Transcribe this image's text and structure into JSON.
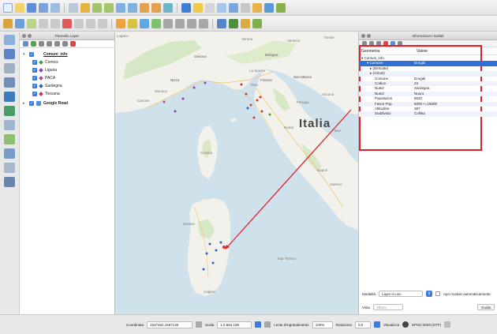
{
  "layers_panel": {
    "title": "Pannello Layer",
    "group": {
      "label": "Comuni_info"
    },
    "items": [
      {
        "label": "Comics",
        "color": "#3da03a"
      },
      {
        "label": "Liguria",
        "color": "#8e3fb5"
      },
      {
        "label": "PACA",
        "color": "#c03c9e"
      },
      {
        "label": "Sardegna",
        "color": "#2a64c8"
      },
      {
        "label": "Toscana",
        "color": "#c63b3b"
      }
    ],
    "basemap": {
      "label": "Google Road"
    }
  },
  "map": {
    "labels": {
      "italia": "Italia",
      "lugano": "Lugano",
      "verona": "Verona",
      "venezia": "Venezia",
      "trieste": "Trieste",
      "genova": "Genova",
      "bologna": "Bologna",
      "nizza": "Nizza",
      "monaco": "Monaco",
      "la_spezia": "La Spezia",
      "pisa": "Pisa",
      "firenze": "Firenze",
      "san_marino": "San Marino",
      "ancona": "Ancona",
      "cannes": "Cannes",
      "perugia": "Perugia",
      "corsica": "Corsica",
      "roma": "Roma",
      "bari": "Bari",
      "napoli": "Napoli",
      "salerno": "Salerno",
      "sassari": "Sassari",
      "mar_tirreno": "Mar Tirreno",
      "cagliari": "Cagliari"
    }
  },
  "info_panel": {
    "title": "Informazioni risultati",
    "col_feature": "Geometria",
    "col_value": "Valore",
    "rows": [
      {
        "key": "Comuni_info",
        "value": ""
      },
      {
        "key": "Comune",
        "value": "Dorgali"
      },
      {
        "key": "(Derivate)",
        "value": ""
      },
      {
        "key": "(Azioni)",
        "value": ""
      },
      {
        "key": "Comune",
        "value": "Dorgali"
      },
      {
        "key": "Codice",
        "value": "23"
      },
      {
        "key": "Nuts2",
        "value": "Sardegna"
      },
      {
        "key": "Nuts3",
        "value": "Nuoro"
      },
      {
        "key": "Popolazion",
        "value": "8522"
      },
      {
        "key": "Fasce Pop.",
        "value": "5000 <=15000"
      },
      {
        "key": "Altitudine",
        "value": "387"
      },
      {
        "key": "Suddivisio",
        "value": "Collina"
      }
    ],
    "mode_label": "Modalità",
    "mode_value": "Layer in uso",
    "auto_open": "Apri modulo automaticamente",
    "view_label": "Vista",
    "view_value": "Albero",
    "help": "Guida"
  },
  "status_bar": {
    "coord_label": "Coordinata",
    "coord_value": "1537462,4467139",
    "scale_label": "Scala",
    "scale_value": "1:2.553.195",
    "magnifier_label": "Lente d'ingrandimento",
    "magnifier_value": "100%",
    "rotation_label": "Rotazione",
    "rotation_value": "0,0",
    "render_label": "Visualizza",
    "crs": "EPSG:3003 (OTF)"
  },
  "colors": {
    "selection": "#2f6fd6",
    "annotation": "#e0212b",
    "checkbox": "#3b7ddd"
  }
}
